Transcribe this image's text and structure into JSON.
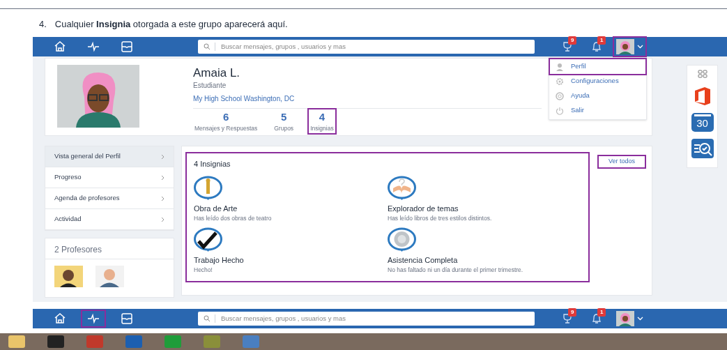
{
  "instruction": {
    "number": "4.",
    "text": "Cualquier **Insignia** otorgada a este grupo aparecerá aquí."
  },
  "top_bar": {
    "nav": [
      {
        "kind": "home",
        "highlighted": false
      },
      {
        "kind": "activity",
        "highlighted": false
      },
      {
        "kind": "inbox",
        "highlighted": false
      }
    ],
    "search_placeholder": "Buscar mensajes, grupos , usuarios y mas",
    "trophy_count": "9",
    "bell_count": "1",
    "avatar_highlighted": true
  },
  "profile": {
    "name": "Amaia L.",
    "role": "Estudiante",
    "school": "My High School Washington, DC",
    "stats": [
      {
        "value": "6",
        "label": "Mensajes y Respuestas",
        "highlighted": false
      },
      {
        "value": "5",
        "label": "Grupos",
        "highlighted": false
      },
      {
        "value": "4",
        "label": "Insignias",
        "highlighted": true
      }
    ]
  },
  "user_menu": [
    {
      "kind": "user",
      "label": "Perfil",
      "highlighted": true
    },
    {
      "kind": "gear",
      "label": "Configuraciones",
      "highlighted": false
    },
    {
      "kind": "help",
      "label": "Ayuda",
      "highlighted": false
    },
    {
      "kind": "power",
      "label": "Salir",
      "highlighted": false
    }
  ],
  "sidebar": [
    {
      "label": "Vista general del Perfil",
      "selected": true
    },
    {
      "label": "Progreso",
      "selected": false
    },
    {
      "label": "Agenda de profesores",
      "selected": false
    },
    {
      "label": "Actividad",
      "selected": false
    }
  ],
  "teachers": {
    "title": "2 Profesores",
    "avatars": [
      {
        "kind": "cartoon"
      },
      {
        "kind": "photo"
      }
    ]
  },
  "app_column": {
    "calendar_day": "30"
  },
  "badges": {
    "title": "4 Insignias",
    "view_all": "Ver todos",
    "highlighted": true,
    "items": [
      {
        "kind": "statue",
        "name": "Obra de Arte",
        "description": "Has leído dos obras de teatro"
      },
      {
        "kind": "book",
        "name": "Explorador de temas",
        "description": "Has leído libros de tres estilos distintos."
      },
      {
        "kind": "check",
        "name": "Trabajo Hecho",
        "description": "Hecho!"
      },
      {
        "kind": "medal",
        "name": "Asistencia Completa",
        "description": "No has faltado ni un día durante el primer trimestre."
      }
    ]
  },
  "bottom_bar": {
    "nav": [
      {
        "kind": "home",
        "highlighted": false
      },
      {
        "kind": "activity",
        "highlighted": true
      },
      {
        "kind": "inbox",
        "highlighted": false
      }
    ],
    "search_placeholder": "Buscar mensajes, grupos , usuarios y mas",
    "trophy_count": "9",
    "bell_count": "1",
    "avatar_highlighted": false
  }
}
